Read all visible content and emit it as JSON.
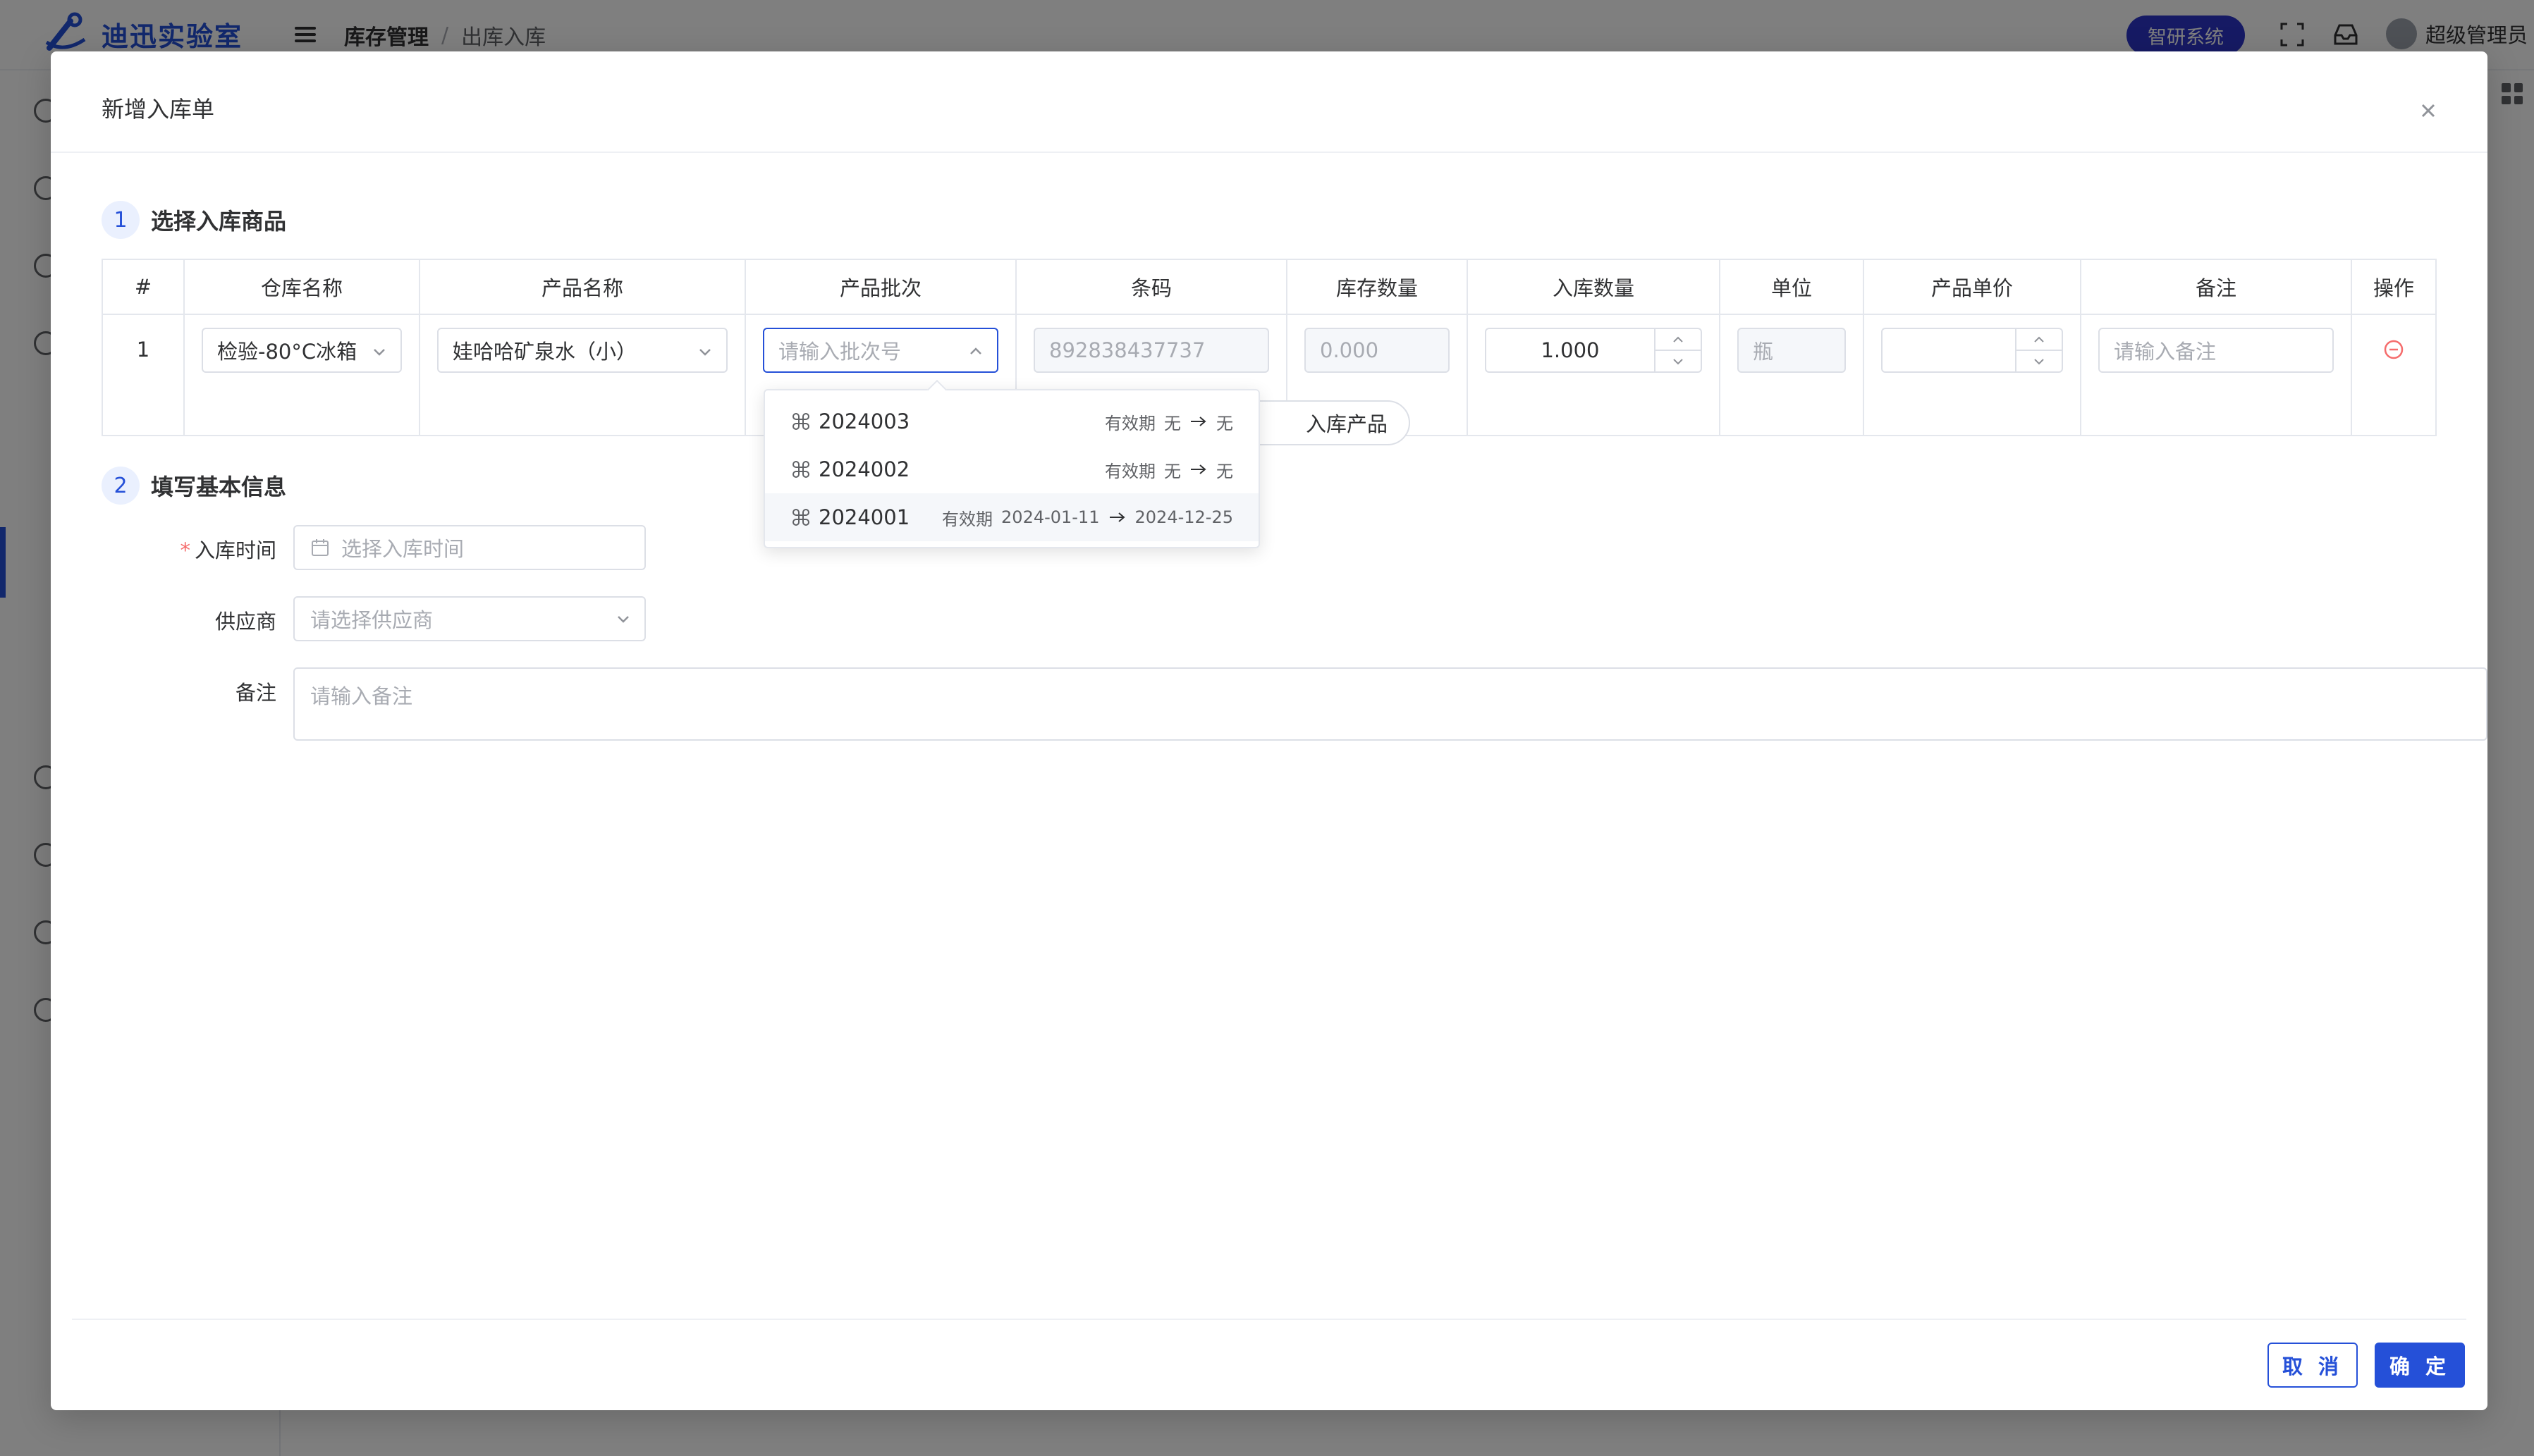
{
  "app": {
    "logo_text": "迪迅实验室",
    "breadcrumb": [
      "库存管理",
      "/",
      "出库入库"
    ],
    "system_button": "智研系统",
    "user_name": "超级管理员"
  },
  "dialog": {
    "title": "新增入库单",
    "section1": {
      "num": "1",
      "title": "选择入库商品"
    },
    "section2": {
      "num": "2",
      "title": "填写基本信息"
    },
    "table": {
      "headers": [
        "#",
        "仓库名称",
        "产品名称",
        "产品批次",
        "条码",
        "库存数量",
        "入库数量",
        "单位",
        "产品单价",
        "备注",
        "操作"
      ],
      "row": {
        "index": "1",
        "warehouse": "检验-80°C冰箱",
        "product": "娃哈哈矿泉水（小）",
        "batch_placeholder": "请输入批次号",
        "barcode": "892838437737",
        "stock_qty": "0.000",
        "inbound_qty": "1.000",
        "unit": "瓶",
        "price": "",
        "remark_placeholder": "请输入备注"
      }
    },
    "add_product_label": "入库产品",
    "batch_dropdown": [
      {
        "batch": "2024003",
        "validity_label": "有效期",
        "from": "无",
        "to": "无"
      },
      {
        "batch": "2024002",
        "validity_label": "有效期",
        "from": "无",
        "to": "无"
      },
      {
        "batch": "2024001",
        "validity_label": "有效期",
        "from": "2024-01-11",
        "to": "2024-12-25"
      }
    ],
    "form": {
      "time_label": "入库时间",
      "time_required_mark": "*",
      "time_placeholder": "选择入库时间",
      "supplier_label": "供应商",
      "supplier_placeholder": "请选择供应商",
      "remark_label": "备注",
      "remark_placeholder": "请输入备注"
    },
    "cancel_label": "取 消",
    "ok_label": "确 定"
  },
  "colors": {
    "primary": "#2550d8",
    "danger": "#f56c6c",
    "system_button": "#2d35c8"
  }
}
